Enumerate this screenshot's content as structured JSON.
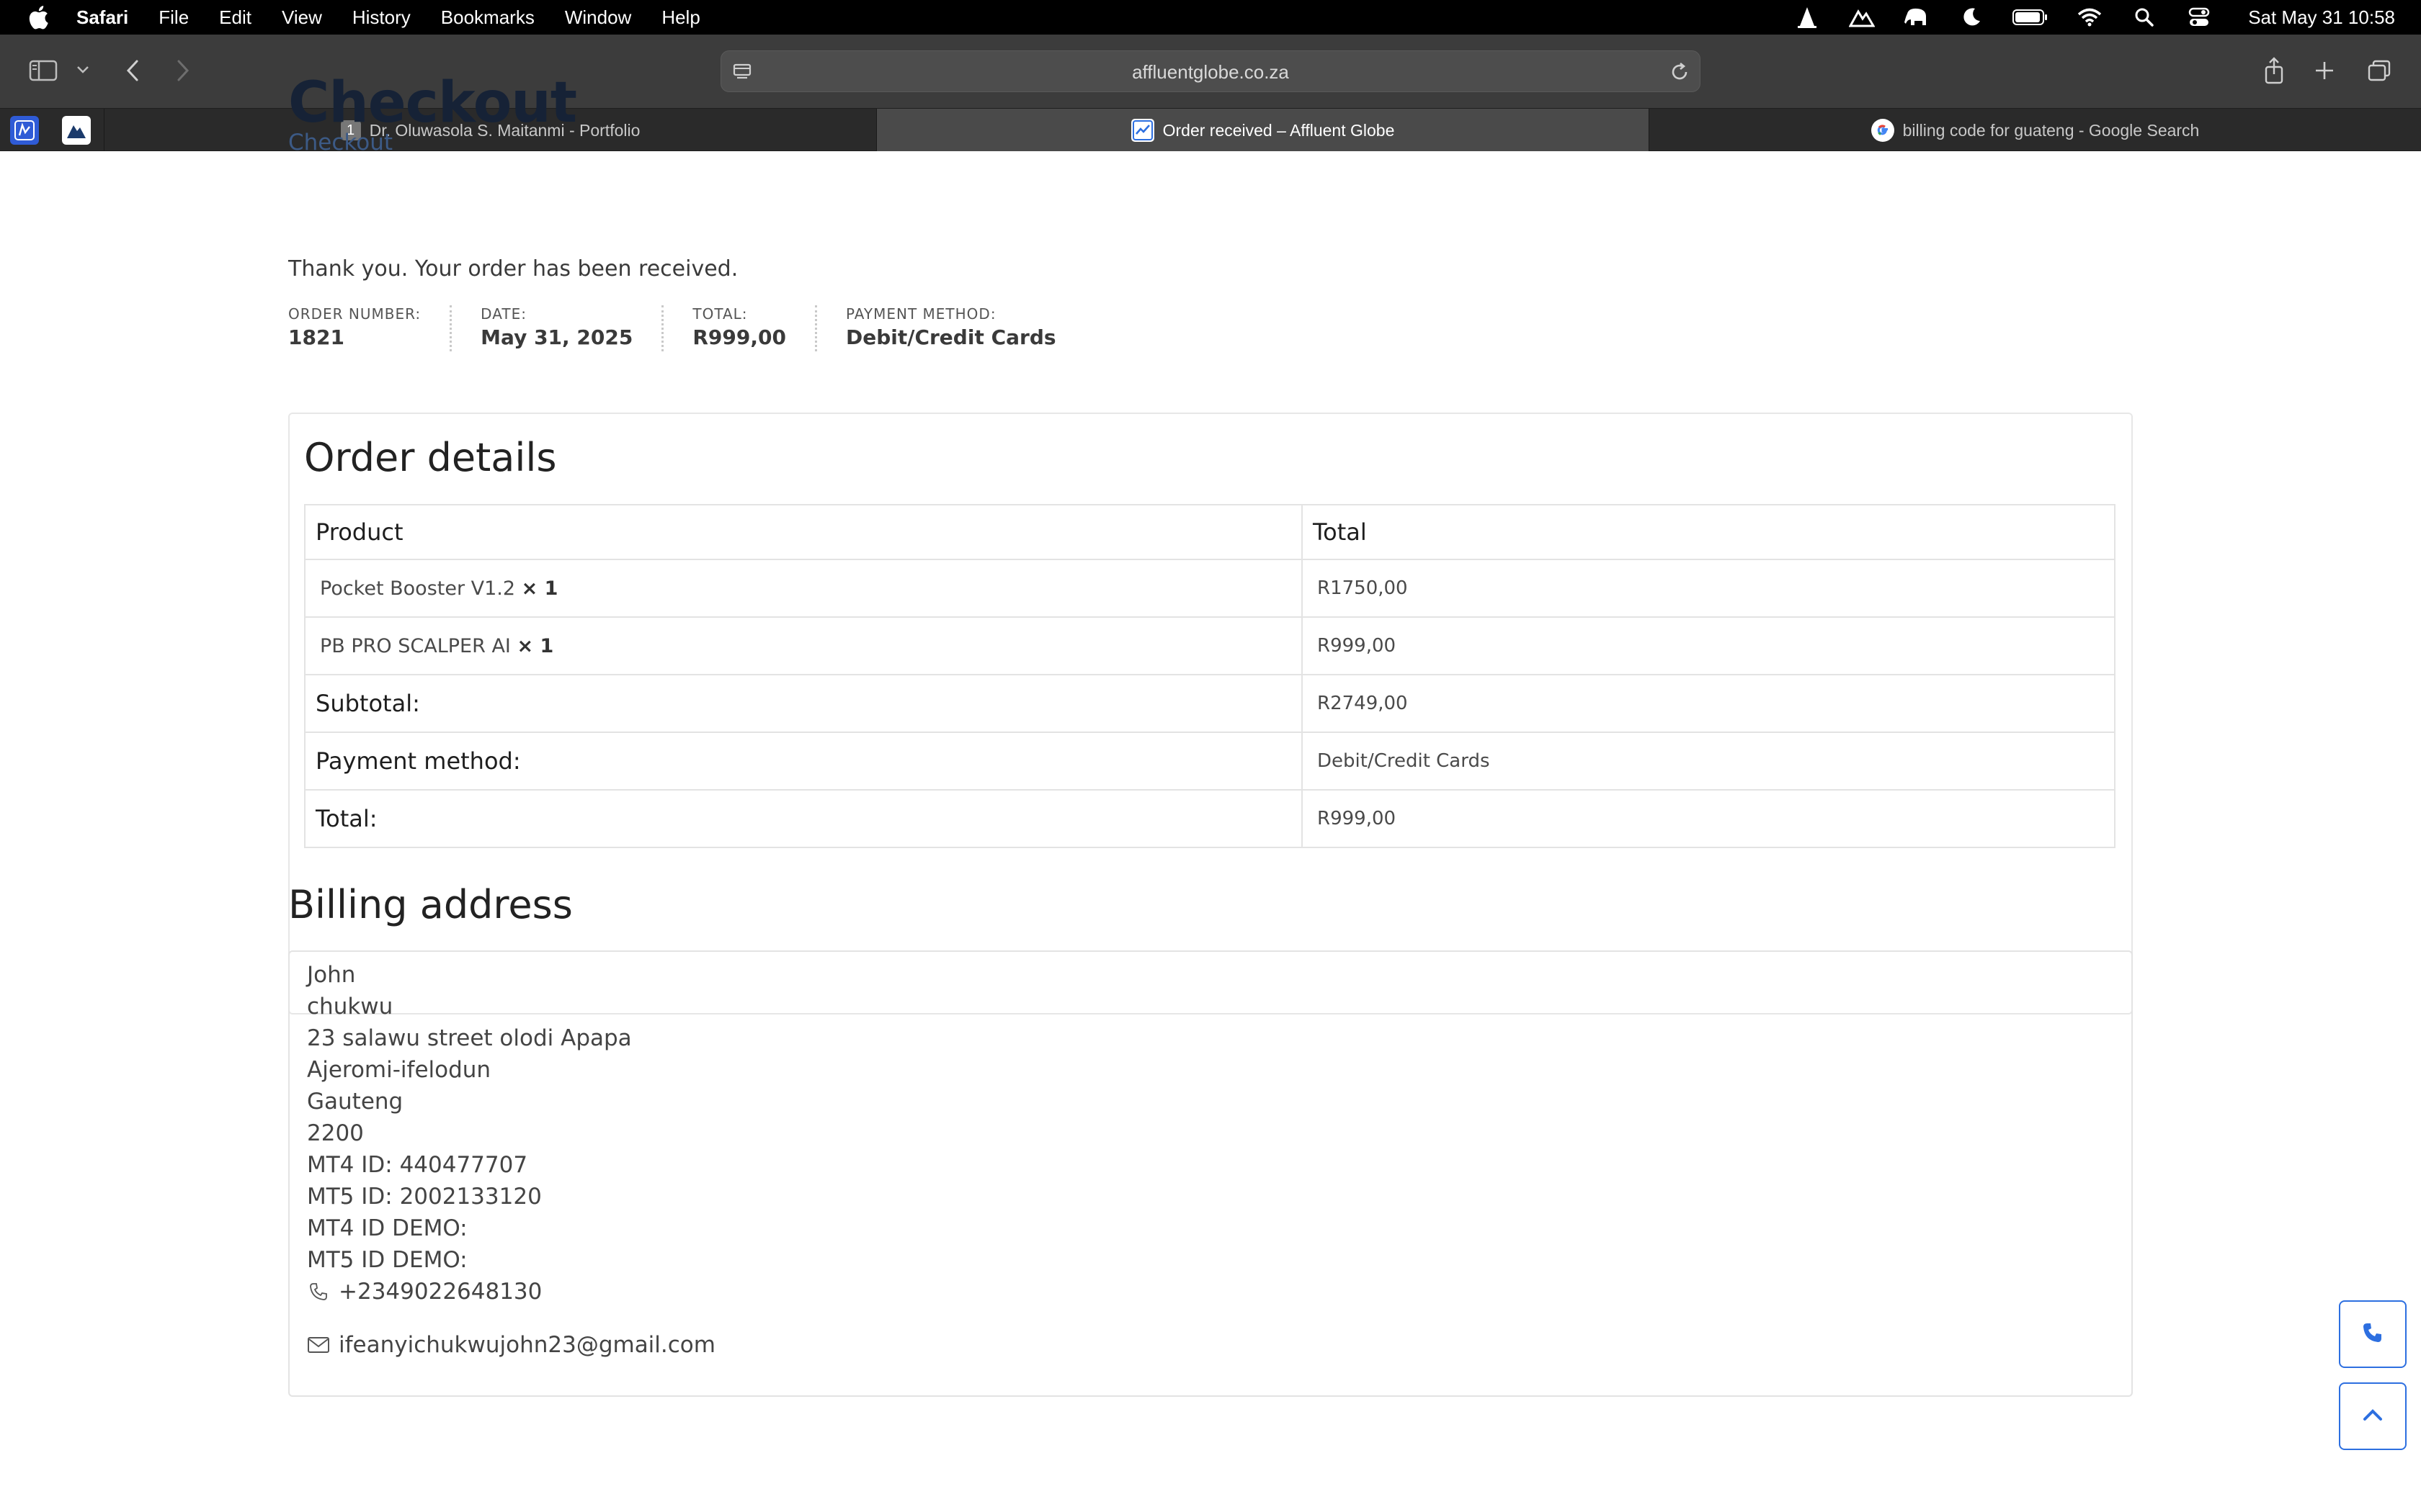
{
  "menubar": {
    "app": "Safari",
    "items": [
      "File",
      "Edit",
      "View",
      "History",
      "Bookmarks",
      "Window",
      "Help"
    ],
    "clock": "Sat May 31  10:58"
  },
  "browser": {
    "url": "affluentglobe.co.za",
    "tabs": [
      {
        "title": "Dr. Oluwasola S. Maitanmi - Portfolio",
        "badge": "1"
      },
      {
        "title": "Order received – Affluent Globe"
      },
      {
        "title": "billing code for guateng - Google Search"
      }
    ]
  },
  "page": {
    "title": "Checkout",
    "breadcrumb": "Checkout",
    "thanks": "Thank you. Your order has been received.",
    "overview": {
      "order_number_label": "ORDER NUMBER:",
      "order_number": "1821",
      "date_label": "DATE:",
      "date": "May 31, 2025",
      "total_label": "TOTAL:",
      "total": "R999,00",
      "payment_label": "PAYMENT METHOD:",
      "payment": "Debit/Credit Cards"
    },
    "order_details": {
      "title": "Order details",
      "headers": [
        "Product",
        "Total"
      ],
      "items": [
        {
          "name": "Pocket Booster V1.2",
          "qty": "× 1",
          "total": "R1750,00"
        },
        {
          "name": "PB PRO SCALPER AI",
          "qty": "× 1",
          "total": "R999,00"
        }
      ],
      "subtotal_label": "Subtotal:",
      "subtotal": "R2749,00",
      "payment_label": "Payment method:",
      "payment": "Debit/Credit Cards",
      "total_label": "Total:",
      "total": "R999,00"
    },
    "billing": {
      "title": "Billing address",
      "lines": [
        "John",
        "chukwu",
        "23 salawu street olodi Apapa",
        "Ajeromi-ifelodun",
        "Gauteng",
        "2200",
        "MT4 ID: 440477707",
        "MT5 ID: 2002133120",
        "MT4 ID DEMO:",
        "MT5 ID DEMO:"
      ],
      "phone": "+2349022648130",
      "email": "ifeanyichukwujohn23@gmail.com"
    }
  },
  "colors": {
    "heading": "#162236",
    "breadcrumb": "#3c5a86",
    "accent": "#2d6fe0"
  },
  "icons": [
    "apple-icon",
    "sidebar-icon",
    "back-icon",
    "forward-icon",
    "reload-icon",
    "share-icon",
    "new-tab-icon",
    "tab-overview-icon",
    "phone-icon",
    "email-icon",
    "chevron-up-icon"
  ]
}
